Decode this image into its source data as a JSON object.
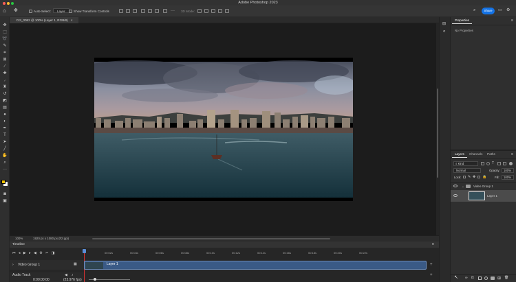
{
  "app": {
    "title": "Adobe Photoshop 2023"
  },
  "colors": {
    "accent": "#1473e6",
    "foreground": "#f2c200",
    "background": "#ffffff"
  },
  "options_bar": {
    "auto_select_label": "Auto-Select:",
    "layer_select": "Layer",
    "transform_controls_label": "Show Transform Controls",
    "mode_3d": "3D Mode:",
    "share_label": "Share"
  },
  "document": {
    "tab_title": "DJI_0082 @ 100% (Layer 1, RGB/8)"
  },
  "status": {
    "zoom": "100%",
    "doc_info": "1920 px x 1080 px (72 ppi)"
  },
  "timeline": {
    "title": "Timeline",
    "ruler": [
      "00:02s",
      "00:04s",
      "00:06s",
      "00:08s",
      "00:10s",
      "00:12s",
      "00:14s",
      "00:16s",
      "00:18s",
      "00:20s",
      "00:22s"
    ],
    "video_group": "Video Group 1",
    "audio_track": "Audio Track",
    "timecode": "0:00:00:00",
    "fps": "(23.976 fps)",
    "clip_label": "Layer 1"
  },
  "properties": {
    "tab": "Properties",
    "empty_text": "No Properties"
  },
  "layers": {
    "tabs": [
      "Layers",
      "Channels",
      "Paths"
    ],
    "kind": "Kind",
    "blend_mode": "Normal",
    "opacity_label": "Opacity:",
    "opacity": "100%",
    "lock_label": "Lock:",
    "fill_label": "Fill:",
    "fill": "100%",
    "items": [
      {
        "name": "Video Group 1",
        "type": "group"
      },
      {
        "name": "Layer 1",
        "type": "layer"
      }
    ]
  }
}
